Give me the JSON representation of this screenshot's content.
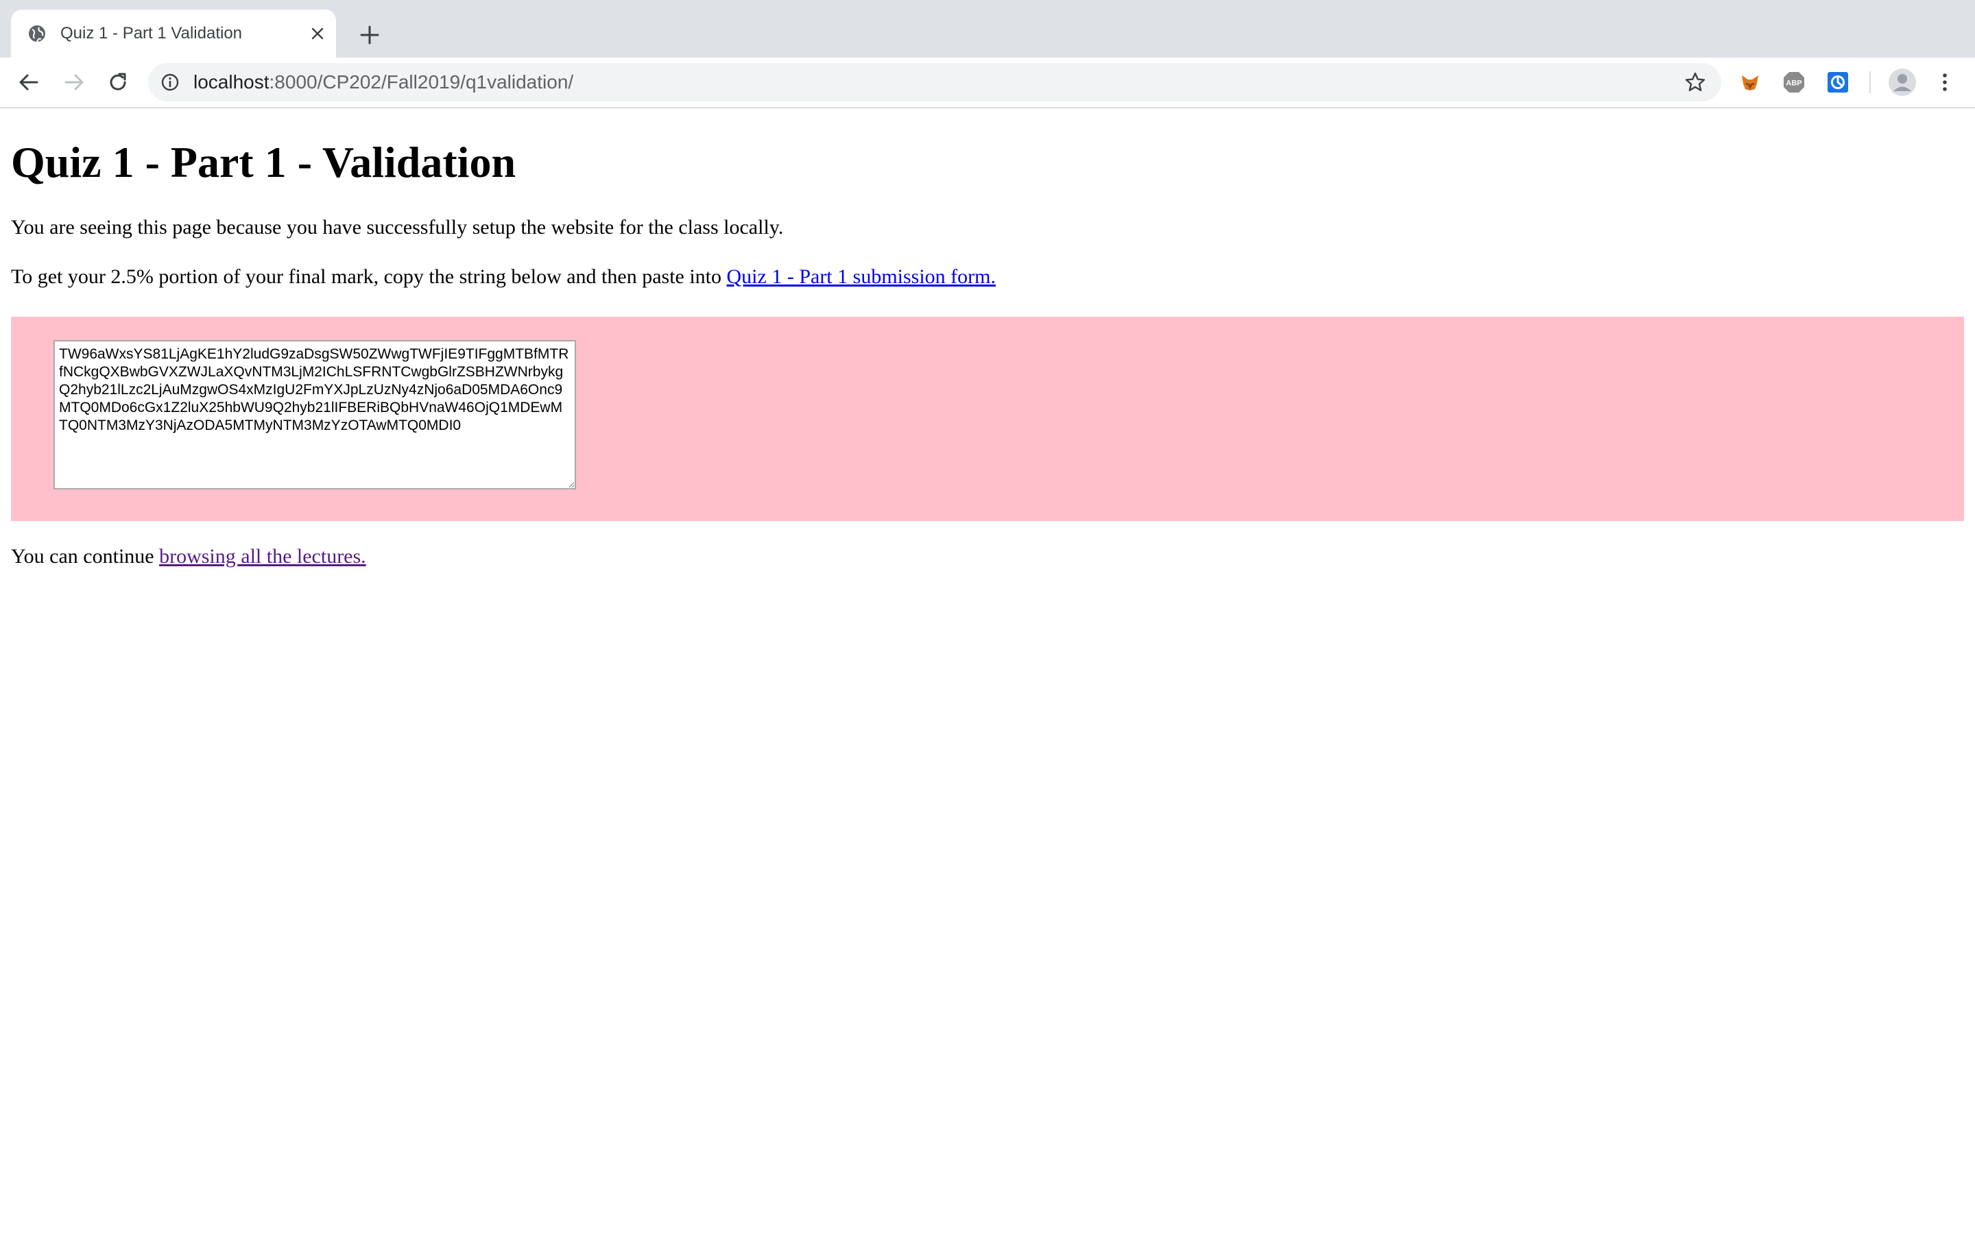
{
  "browser": {
    "tab": {
      "title": "Quiz 1 - Part 1 Validation",
      "icon": "globe-icon"
    },
    "new_tab_icon": "plus-icon",
    "address": {
      "host": "localhost",
      "rest": ":8000/CP202/Fall2019/q1validation/"
    },
    "extensions": [
      "metamask-icon",
      "adblock-plus-icon",
      "extension-icon"
    ]
  },
  "page": {
    "heading": "Quiz 1 - Part 1 - Validation",
    "intro": "You are seeing this page because you have successfully setup the website for the class locally.",
    "instruction_prefix": "To get your 2.5% portion of your final mark, copy the string below and then paste into ",
    "submission_link": "Quiz 1 - Part 1 submission form.",
    "token": "TW96aWxsYS81LjAgKE1hY2ludG9zaDsgSW50ZWwgTWFjIE9TIFggMTBfMTRfNCkgQXBwbGVXZWJLaXQvNTM3LjM2IChLSFRNTCwgbGlrZSBHZWNrbykgQ2hyb21lLzc2LjAuMzgwOS4xMzIgU2FmYXJpLzUzNy4zNjo6aD05MDA6Onc9MTQ0MDo6cGx1Z2luX25hbWU9Q2hyb21lIFBERiBQbHVnaW46OjQ1MDEwMTQ0NTM3MzY3NjAzODA5MTMyNTM3MzYzOTAwMTQ0MDI0",
    "continue_prefix": "You can continue ",
    "lectures_link": "browsing all the lectures."
  },
  "colors": {
    "panel_background": "#ffc0cb",
    "link": "#0000ee",
    "visited_link": "#551a8b"
  }
}
